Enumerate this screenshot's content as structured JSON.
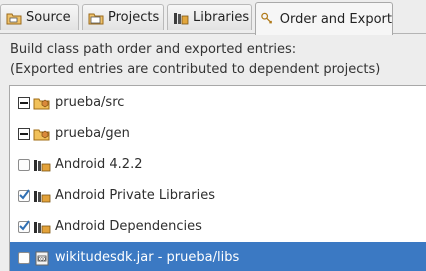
{
  "tabs": [
    {
      "label": "Source",
      "icon": "source-folder-icon",
      "active": false
    },
    {
      "label": "Projects",
      "icon": "projects-icon",
      "active": false
    },
    {
      "label": "Libraries",
      "icon": "libraries-icon",
      "active": false
    },
    {
      "label": "Order and Export",
      "icon": "order-export-icon",
      "active": true
    }
  ],
  "description": {
    "line1": "Build class path order and exported entries:",
    "line2": "(Exported entries are contributed to dependent projects)"
  },
  "entries": [
    {
      "label": "prueba/src",
      "icon": "package-folder-icon",
      "state": "mixed",
      "selected": false
    },
    {
      "label": "prueba/gen",
      "icon": "package-folder-icon",
      "state": "mixed",
      "selected": false
    },
    {
      "label": "Android 4.2.2",
      "icon": "library-icon",
      "state": "unchecked",
      "selected": false
    },
    {
      "label": "Android Private Libraries",
      "icon": "library-icon",
      "state": "checked",
      "selected": false
    },
    {
      "label": "Android Dependencies",
      "icon": "library-icon",
      "state": "checked",
      "selected": false
    },
    {
      "label": "wikitudesdk.jar - prueba/libs",
      "icon": "jar-icon",
      "state": "unchecked",
      "selected": true
    }
  ],
  "colors": {
    "selection": "#3b79c3",
    "check": "#2f6fb3",
    "folder": "#e8a33a"
  }
}
